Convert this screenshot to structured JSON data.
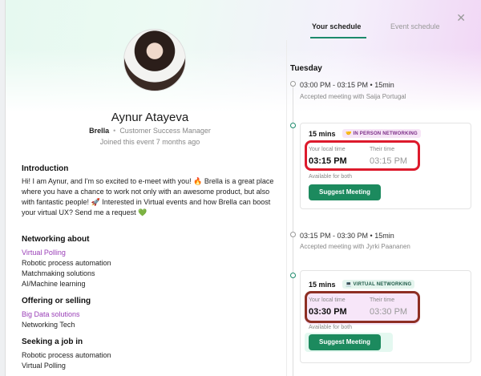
{
  "profile": {
    "name": "Aynur Atayeva",
    "org": "Brella",
    "role": "Customer Success Manager",
    "joined": "Joined this event 7 months ago"
  },
  "sections": {
    "intro_title": "Introduction",
    "intro_text": "Hi! I am Aynur, and I'm so excited to e-meet with you! 🔥 Brella is a great place where you have a chance to work not only with an awesome product, but also with fantastic people! 🚀 Interested in Virtual events and how Brella can boost your virtual UX? Send me a request 💚",
    "networking_title": "Networking about",
    "networking_items": [
      "Virtual Polling",
      "Robotic process automation",
      "Matchmaking solutions",
      "AI/Machine learning"
    ],
    "offering_title": "Offering or selling",
    "offering_items": [
      "Big Data solutions",
      "Networking Tech"
    ],
    "seeking_title": "Seeking a job in",
    "seeking_items": [
      "Robotic process automation",
      "Virtual Polling"
    ]
  },
  "tabs": {
    "your_schedule": "Your schedule",
    "event_schedule": "Event schedule"
  },
  "schedule": {
    "day": "Tuesday",
    "slot1_time": "03:00 PM - 03:15 PM • 15min",
    "slot1_sub": "Accepted meeting with Saija Portugal",
    "card1": {
      "duration": "15 mins",
      "badge": "🤝 IN PERSON NETWORKING",
      "local_label": "Your local time",
      "their_label": "Their time",
      "local_time": "03:15 PM",
      "their_time": "03:15 PM",
      "available": "Available for both",
      "button": "Suggest Meeting"
    },
    "slot2_time": "03:15 PM - 03:30 PM • 15min",
    "slot2_sub": "Accepted meeting with Jyrki Paananen",
    "card2": {
      "duration": "15 mins",
      "badge": "💻 VIRTUAL NETWORKING",
      "local_label": "Your local time",
      "their_label": "Their time",
      "local_time": "03:30 PM",
      "their_time": "03:30 PM",
      "available": "Available for both",
      "button": "Suggest Meeting"
    }
  },
  "icons": {
    "close": "close-icon"
  },
  "colors": {
    "accent": "#1c8a5e",
    "link": "#9a3fb7",
    "highlight1": "#dd1a2c",
    "highlight2": "#8e2f24"
  }
}
